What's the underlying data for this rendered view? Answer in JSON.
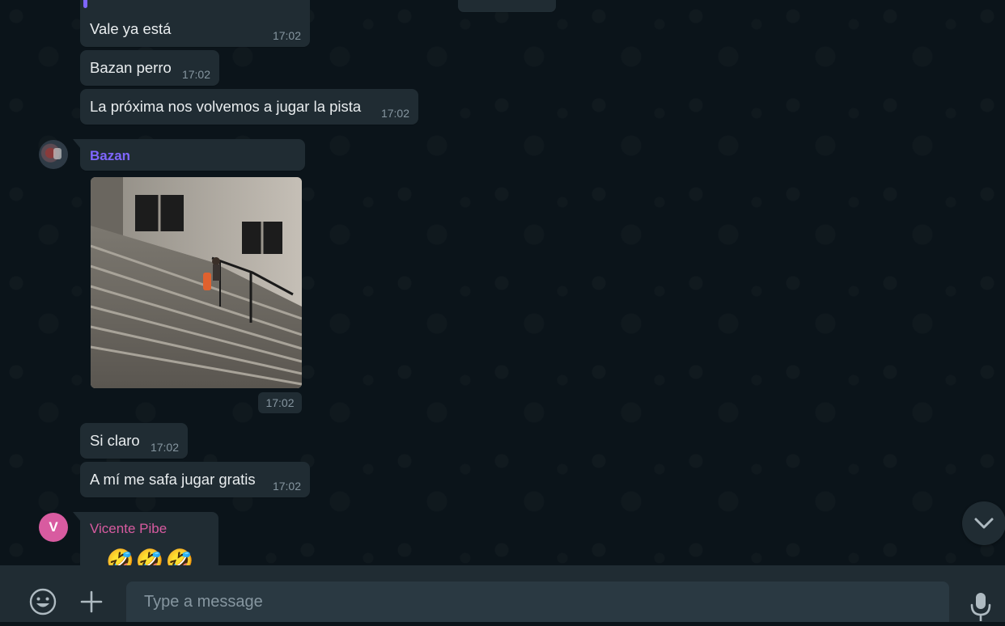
{
  "messages": [
    {
      "text": "Vale ya está",
      "time": "17:02"
    },
    {
      "text": "Bazan perro",
      "time": "17:02"
    },
    {
      "text": "La próxima nos volvemos a jugar la pista",
      "time": "17:02"
    },
    {
      "sender": "Bazan",
      "sender_color": "#7f66ff",
      "media": "image",
      "time": "17:02"
    },
    {
      "text": "Si claro",
      "time": "17:02"
    },
    {
      "text": "A mí me safa jugar gratis",
      "time": "17:02"
    },
    {
      "sender": "Vicente Pibe",
      "sender_color": "#d85ba0",
      "avatar_letter": "V",
      "avatar_color": "#d85ba0",
      "emoji": "🤣🤣🤣"
    }
  ],
  "composer": {
    "placeholder": "Type a message",
    "emoji_icon": "emoji-icon",
    "attach_icon": "plus-icon",
    "mic_icon": "microphone-icon"
  },
  "scroll_button_icon": "chevron-down-icon",
  "colors": {
    "bubble": "#202c33",
    "background": "#0b141a",
    "composer": "#202c33",
    "input": "#2a3942",
    "timestamp": "#8696a0"
  }
}
